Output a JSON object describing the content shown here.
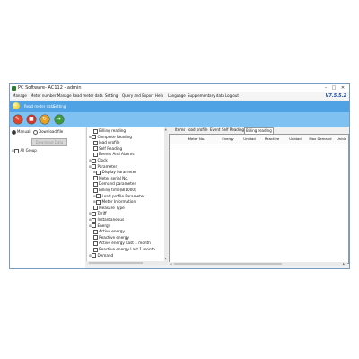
{
  "window": {
    "title": "PC Software- AC112 - admin",
    "controls": [
      "–",
      "□",
      "✕"
    ]
  },
  "menu": {
    "items": [
      "Manage",
      "Meter number Manage",
      "Read meter data",
      "Setting",
      "Query and Export",
      "Help",
      "Language",
      "Supplementary data",
      "Log out"
    ],
    "version": "V7.5.5.2"
  },
  "ribbon_tabs": [
    "Read meter data",
    "Setting"
  ],
  "toolbar": {
    "buttons": [
      {
        "icon": "read-icon",
        "color": "#e0442b"
      },
      {
        "icon": "stop-icon",
        "color": "#d9332a"
      },
      {
        "icon": "refresh-icon",
        "color": "#e8a020"
      },
      {
        "icon": "export-icon",
        "color": "#3a9e3a"
      }
    ]
  },
  "left": {
    "manual_label": "Manual",
    "download_label": "Download file",
    "download_button": "Download Data",
    "group_label": "All Group"
  },
  "tree": [
    {
      "label": "Billing reading",
      "level": 1,
      "expander": false
    },
    {
      "label": "Complete Reading",
      "level": 0,
      "expander": true
    },
    {
      "label": "load profile",
      "level": 1,
      "expander": false
    },
    {
      "label": "Self Reading",
      "level": 1,
      "expander": false
    },
    {
      "label": "Events And Alarms",
      "level": 1,
      "expander": false
    },
    {
      "label": "Clock",
      "level": 0,
      "expander": true
    },
    {
      "label": "Parameter",
      "level": 0,
      "expander": true
    },
    {
      "label": "Display Parameter",
      "level": 1,
      "expander": true
    },
    {
      "label": "Meter serial No.",
      "level": 1,
      "expander": false
    },
    {
      "label": "Demand parameter",
      "level": 1,
      "expander": false
    },
    {
      "label": "Billing time(BI1000)",
      "level": 1,
      "expander": false
    },
    {
      "label": "Load profile Parameter",
      "level": 1,
      "expander": true
    },
    {
      "label": "Meter Information",
      "level": 1,
      "expander": true
    },
    {
      "label": "Measure Type",
      "level": 1,
      "expander": false
    },
    {
      "label": "Tariff",
      "level": 0,
      "expander": true
    },
    {
      "label": "Instantaneous",
      "level": 0,
      "expander": true
    },
    {
      "label": "Energy",
      "level": 0,
      "expander": true
    },
    {
      "label": "Active energy",
      "level": 1,
      "expander": false
    },
    {
      "label": "Reactive energy",
      "level": 1,
      "expander": false
    },
    {
      "label": "Active energy Last 1 month",
      "level": 1,
      "expander": false
    },
    {
      "label": "Reactive energy  Last 1 month",
      "level": 1,
      "expander": false
    },
    {
      "label": "Demand",
      "level": 0,
      "expander": true
    }
  ],
  "result_tabs": [
    "Items",
    "load profile",
    "Event",
    "Self Reading",
    "Billing reading"
  ],
  "active_result_tab": 4,
  "grid_columns": [
    "Meter No.",
    "Energy",
    "Unidad",
    "Reactive",
    "Unidad",
    "Max Demand",
    "Unida"
  ]
}
